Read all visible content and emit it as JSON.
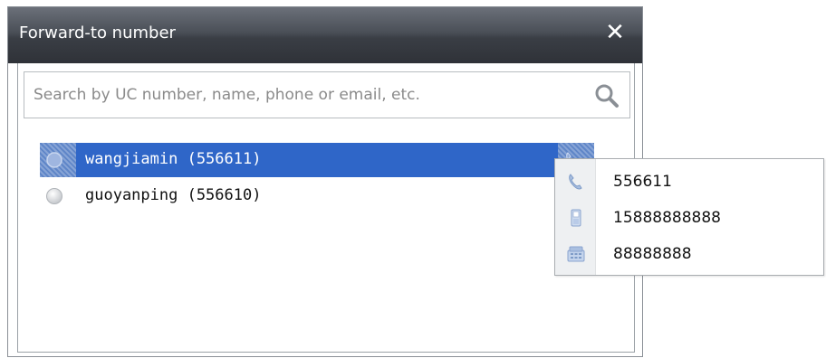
{
  "window": {
    "title": "Forward-to number",
    "close_symbol": "✕"
  },
  "search": {
    "placeholder": "Search by UC number, name, phone or email, etc.",
    "value": ""
  },
  "contacts": [
    {
      "label": "wangjiamin (556611)",
      "selected": true
    },
    {
      "label": "guoyanping (556610)",
      "selected": false
    }
  ],
  "popup": {
    "items": [
      {
        "icon": "uc-phone-icon",
        "value": "556611"
      },
      {
        "icon": "mobile-phone-icon",
        "value": "15888888888"
      },
      {
        "icon": "desk-phone-icon",
        "value": "88888888"
      }
    ]
  },
  "colors": {
    "titlebar": "#3a3e45",
    "selection": "#2f66c8",
    "popup_gutter": "#eef0f2"
  }
}
